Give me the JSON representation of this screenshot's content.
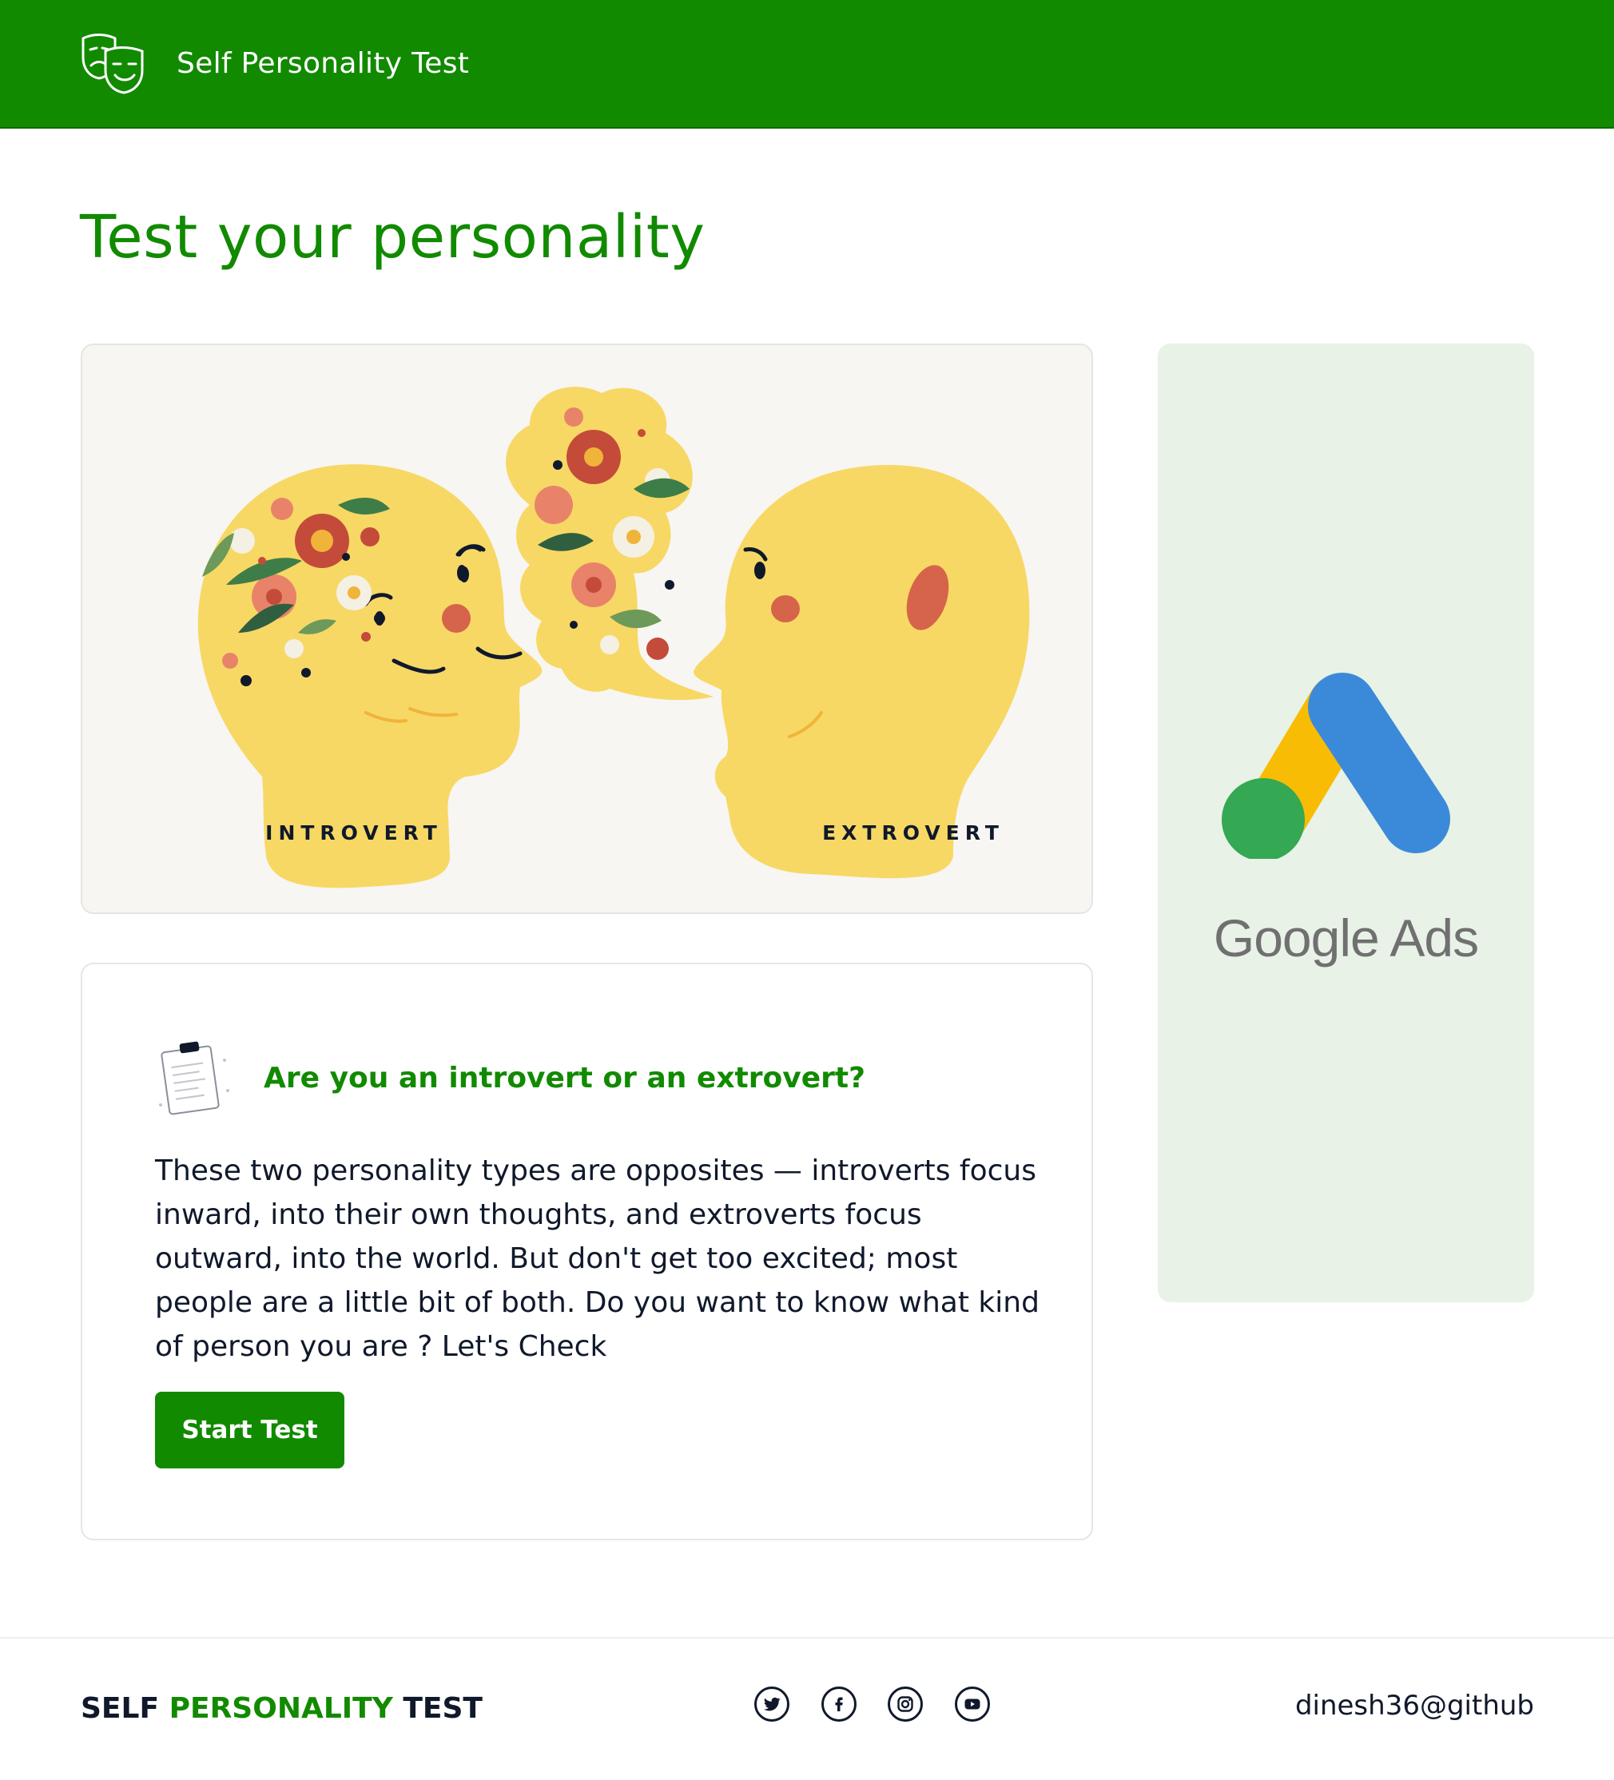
{
  "navbar": {
    "logo_icon": "theater-masks-icon",
    "title": "Self Personality Test"
  },
  "main": {
    "heading": "Test your personality",
    "hero": {
      "introvert_label": "INTROVERT",
      "extrovert_label": "EXTROVERT"
    },
    "card": {
      "icon": "clipboard-document-icon",
      "heading": "Are you an introvert or an extrovert?",
      "text": "These two personality types are opposites — introverts focus inward, into their own thoughts, and extroverts focus outward, into the world. But don't get too excited; most people are a little bit of both. Do you want to know what kind of person you are ? Let's Check",
      "button_label": "Start Test"
    }
  },
  "ad": {
    "brand": "Google Ads",
    "colors": {
      "yellow": "#f9bc05",
      "blue": "#3b8ad9",
      "green": "#34a853",
      "background": "#e8f2e7"
    }
  },
  "footer": {
    "brand_part1": "SELF",
    "brand_part2": "PERSONALITY",
    "brand_part3": "TEST",
    "social": [
      "twitter-icon",
      "facebook-icon",
      "instagram-icon",
      "youtube-icon"
    ],
    "handle": "dinesh36@github"
  },
  "colors": {
    "primary": "#118a00",
    "text": "#10192b",
    "skin": "#f7d865",
    "cheek": "#d6644a"
  }
}
